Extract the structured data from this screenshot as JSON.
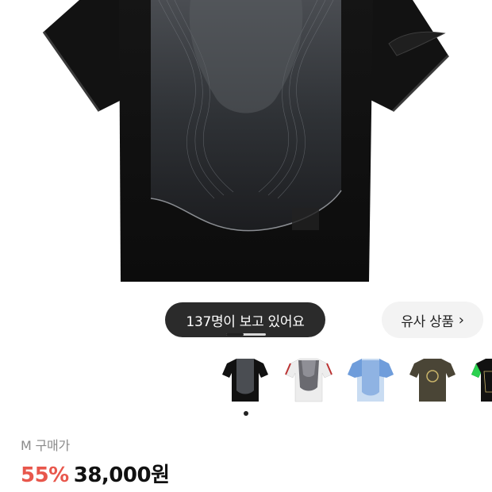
{
  "product": {
    "image_alt": "black gradient jersey",
    "viewers_text": "137명이 보고 있어요",
    "similar_label": "유사 상품",
    "size_label": "M 구매가",
    "discount": "55%",
    "price": "38,000원",
    "carousel_position": 0.44
  },
  "colors": {
    "discount": "#e8574c",
    "pill_bg": "#2b2b2b",
    "similar_bg": "#f3f3f3"
  },
  "thumbnails": [
    {
      "name": "black-jersey-thumb"
    },
    {
      "name": "white-gradient-jersey-thumb"
    },
    {
      "name": "blue-jersey-thumb"
    },
    {
      "name": "olive-jersey-thumb"
    },
    {
      "name": "black-green-jersey-thumb"
    }
  ]
}
